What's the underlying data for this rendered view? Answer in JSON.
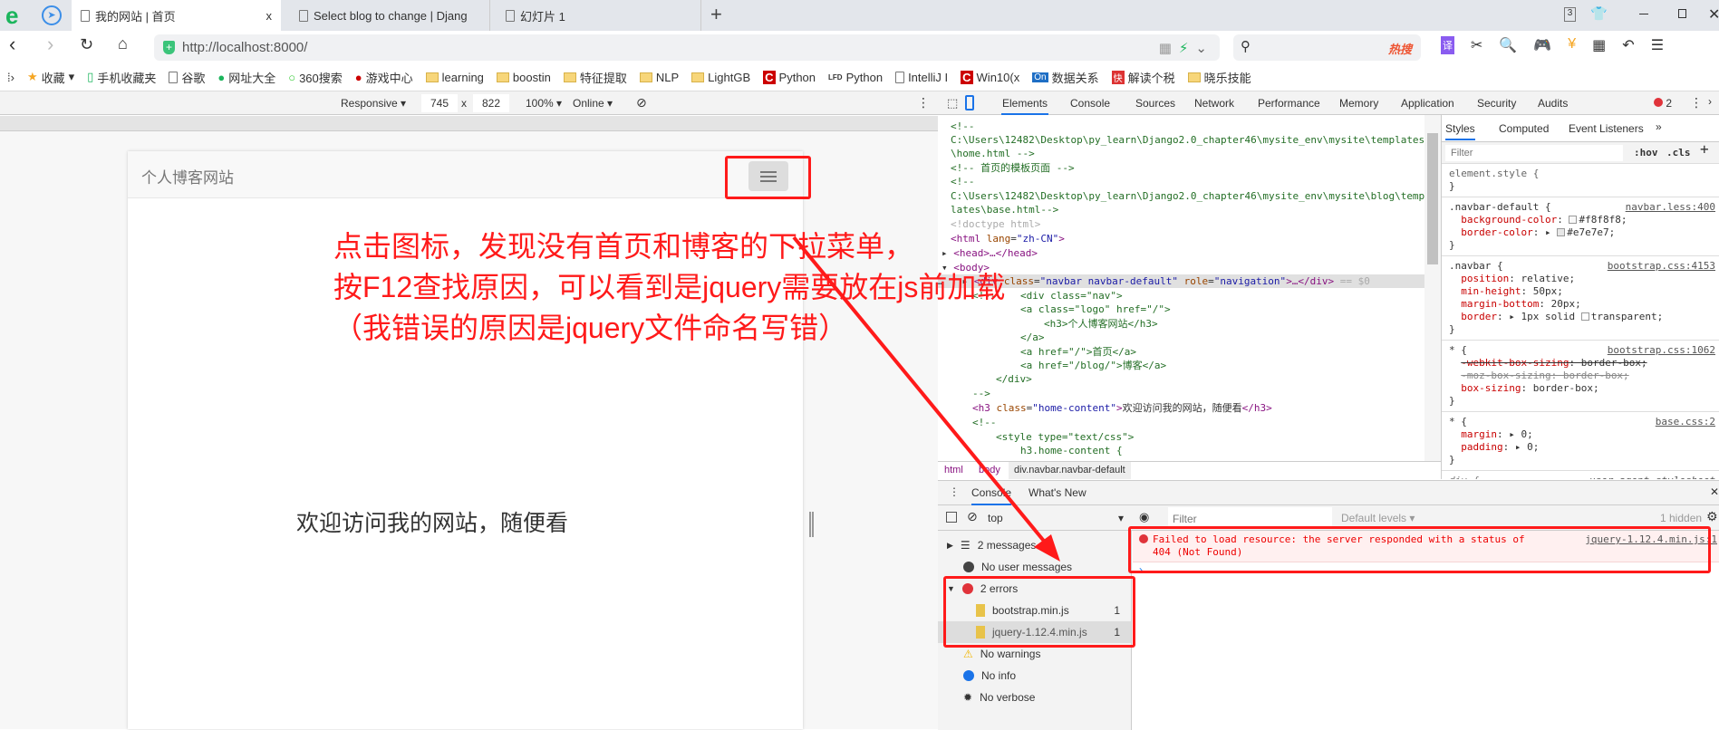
{
  "browser": {
    "tabs": [
      {
        "label": "我的网站 | 首页",
        "active": true
      },
      {
        "label": "Select blog to change | Djang"
      },
      {
        "label": "幻灯片 1"
      }
    ],
    "tab_count": "3",
    "close_tab": "x",
    "new_tab": "+",
    "url": "http://localhost:8000/",
    "search_hot": "热搜",
    "bookmarks": [
      "收藏",
      "手机收藏夹",
      "谷歌",
      "网址大全",
      "360搜索",
      "游戏中心",
      "learning",
      "boostin",
      "特征提取",
      "NLP",
      "LightGB",
      "Python",
      "Python",
      "IntelliJ I",
      "Win10(x",
      "数据关系",
      "解读个税",
      "晓乐技能"
    ]
  },
  "device_toolbar": {
    "mode": "Responsive",
    "width": "745",
    "x": "x",
    "height": "822",
    "zoom": "100%",
    "network": "Online"
  },
  "page": {
    "brand": "个人博客网站",
    "welcome": "欢迎访问我的网站，随便看"
  },
  "annotation": {
    "lines": [
      "点击图标，发现没有首页和博客的下拉菜单，",
      "按F12查找原因，可以看到是jquery需要放在js前加载",
      "（我错误的原因是jquery文件命名写错）"
    ],
    "color": "#ff1a1a"
  },
  "devtools": {
    "tabs": [
      "Elements",
      "Console",
      "Sources",
      "Network",
      "Performance",
      "Memory",
      "Application",
      "Security",
      "Audits"
    ],
    "error_count": "2",
    "breadcrumb": [
      "html",
      "body",
      "div.navbar.navbar-default"
    ],
    "styles_tabs": [
      "Styles",
      "Computed",
      "Event Listeners",
      "»"
    ],
    "filter_placeholder": "Filter",
    "hov": ":hov",
    "cls": ".cls",
    "plus": "+",
    "drawer_tabs": [
      "Console",
      "What's New"
    ],
    "context": "top",
    "console_filter_placeholder": "Filter",
    "levels": "Default levels ▾",
    "hidden": "1 hidden",
    "sidebar": [
      {
        "label": "2 messages",
        "icon": "list-icon"
      },
      {
        "label": "No user messages",
        "icon": "user-icon"
      },
      {
        "label": "2 errors",
        "icon": "error-icon"
      },
      {
        "label": "bootstrap.min.js",
        "count": "1",
        "icon": "file-icon"
      },
      {
        "label": "jquery-1.12.4.min.js",
        "count": "1",
        "icon": "file-icon"
      },
      {
        "label": "No warnings",
        "icon": "warning-icon"
      },
      {
        "label": "No info",
        "icon": "info-icon"
      },
      {
        "label": "No verbose",
        "icon": "bug-icon"
      }
    ],
    "error_message": "Failed to load resource: the server responded with a status of 404 (Not Found)",
    "error_source": "jquery-1.12.4.min.js:1"
  }
}
